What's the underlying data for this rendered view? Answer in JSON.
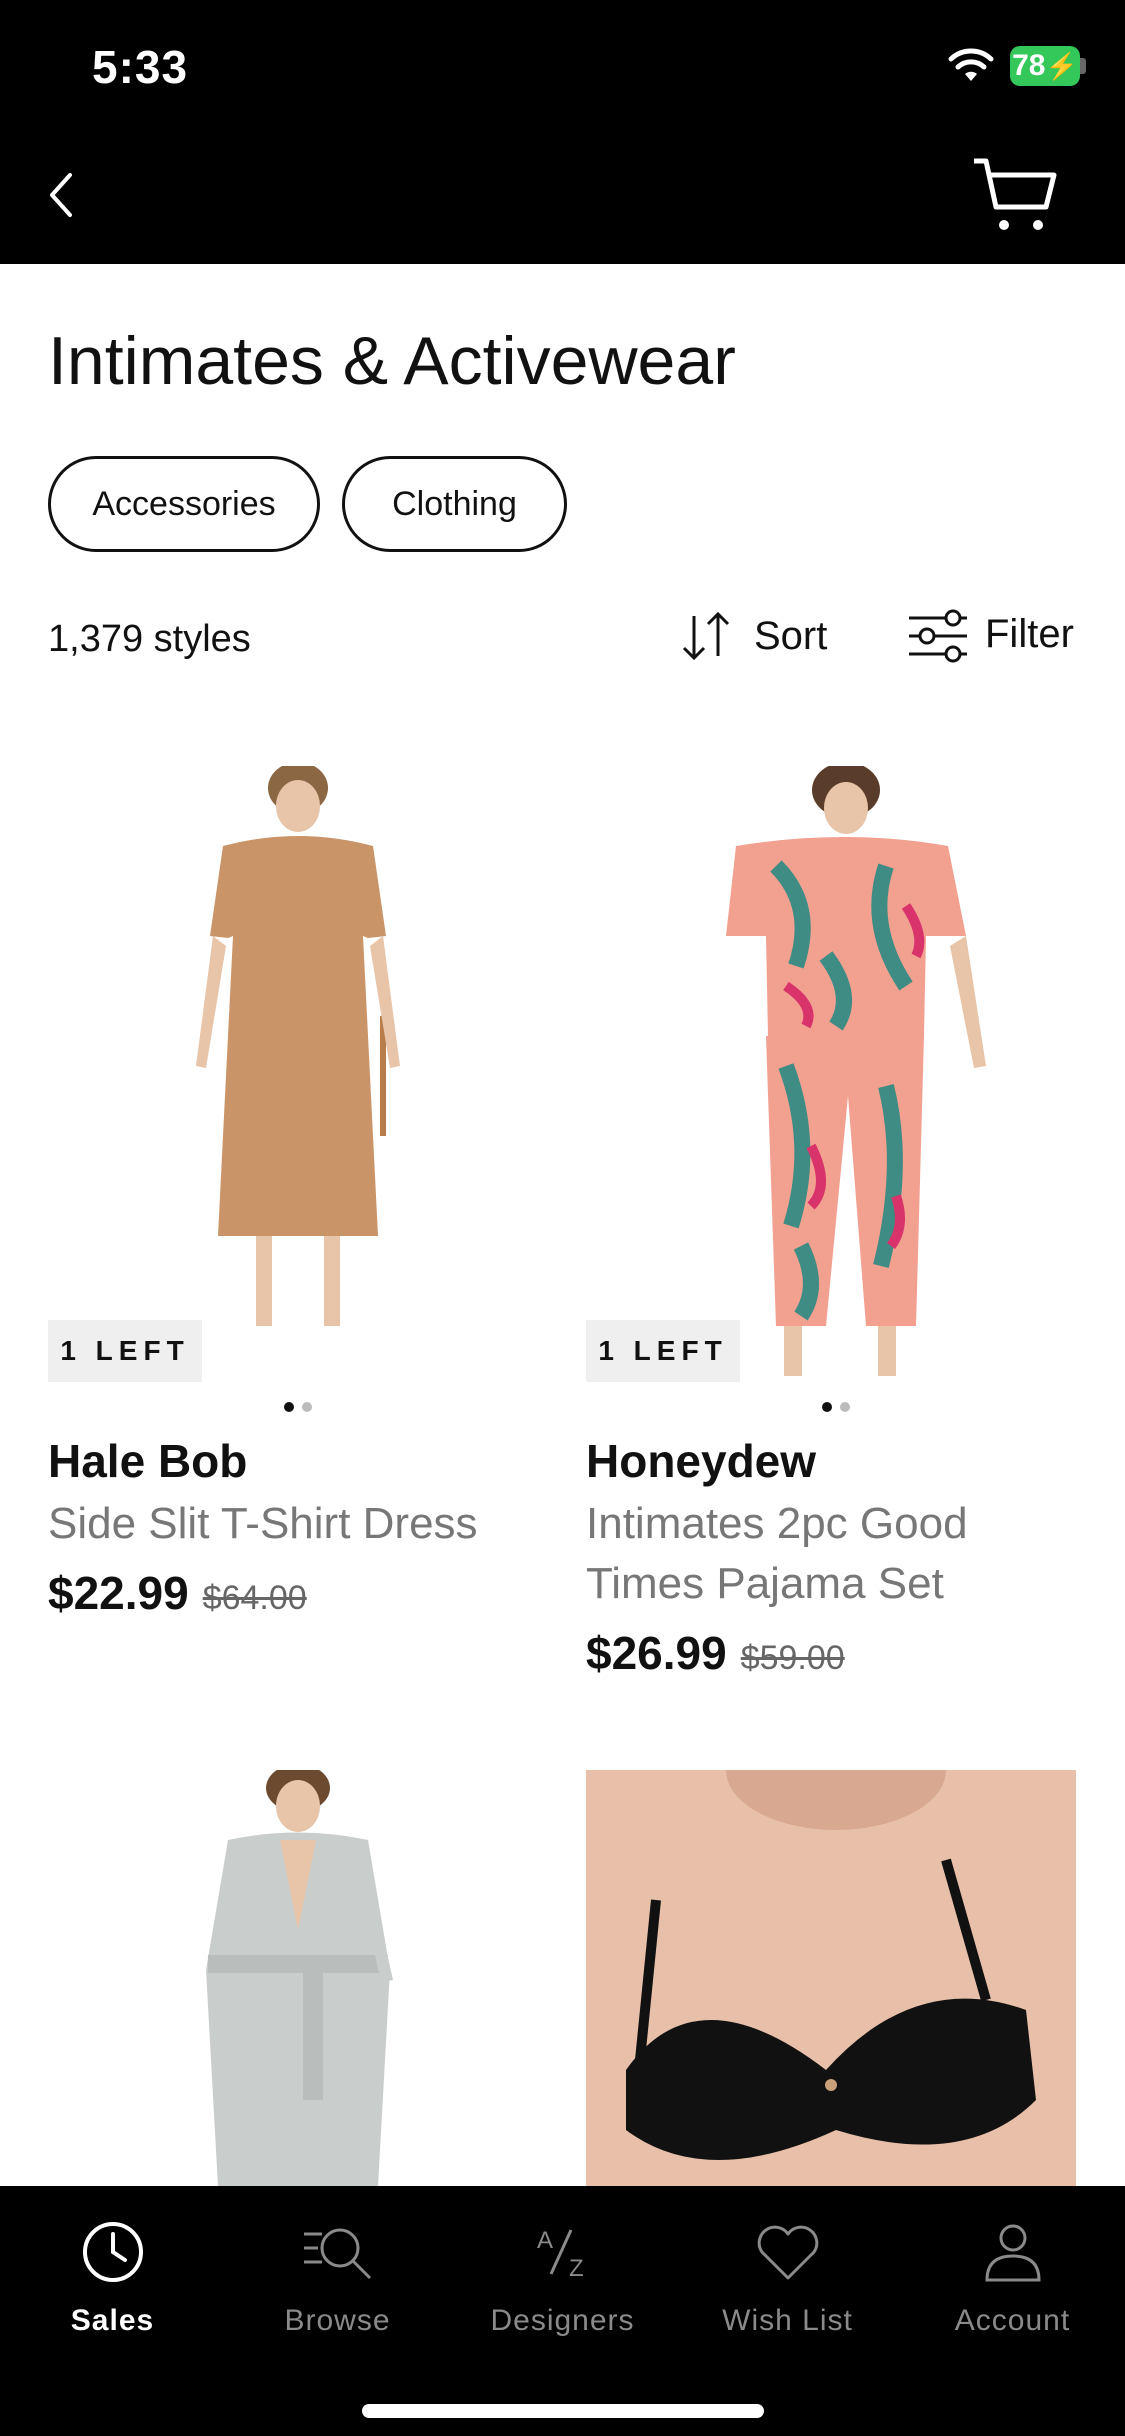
{
  "status": {
    "time": "5:33",
    "battery": "78"
  },
  "page": {
    "title": "Intimates & Activewear"
  },
  "chips": [
    "Accessories",
    "Clothing"
  ],
  "toolbar": {
    "count": "1,379 styles",
    "sort_label": "Sort",
    "filter_label": "Filter"
  },
  "products": [
    {
      "badge": "1 LEFT",
      "brand": "Hale Bob",
      "name": "Side Slit T-Shirt Dress",
      "price": "$22.99",
      "original": "$64.00"
    },
    {
      "badge": "1 LEFT",
      "brand": "Honeydew",
      "name": "Intimates 2pc Good Times Pajama Set",
      "price": "$26.99",
      "original": "$59.00"
    }
  ],
  "tabs": [
    {
      "label": "Sales",
      "icon": "clock-icon",
      "active": true
    },
    {
      "label": "Browse",
      "icon": "search-list-icon",
      "active": false
    },
    {
      "label": "Designers",
      "icon": "a-z-icon",
      "active": false
    },
    {
      "label": "Wish List",
      "icon": "heart-icon",
      "active": false
    },
    {
      "label": "Account",
      "icon": "person-icon",
      "active": false
    }
  ],
  "colors": {
    "accent": "#000000",
    "battery": "#34c759",
    "muted": "#777777"
  }
}
